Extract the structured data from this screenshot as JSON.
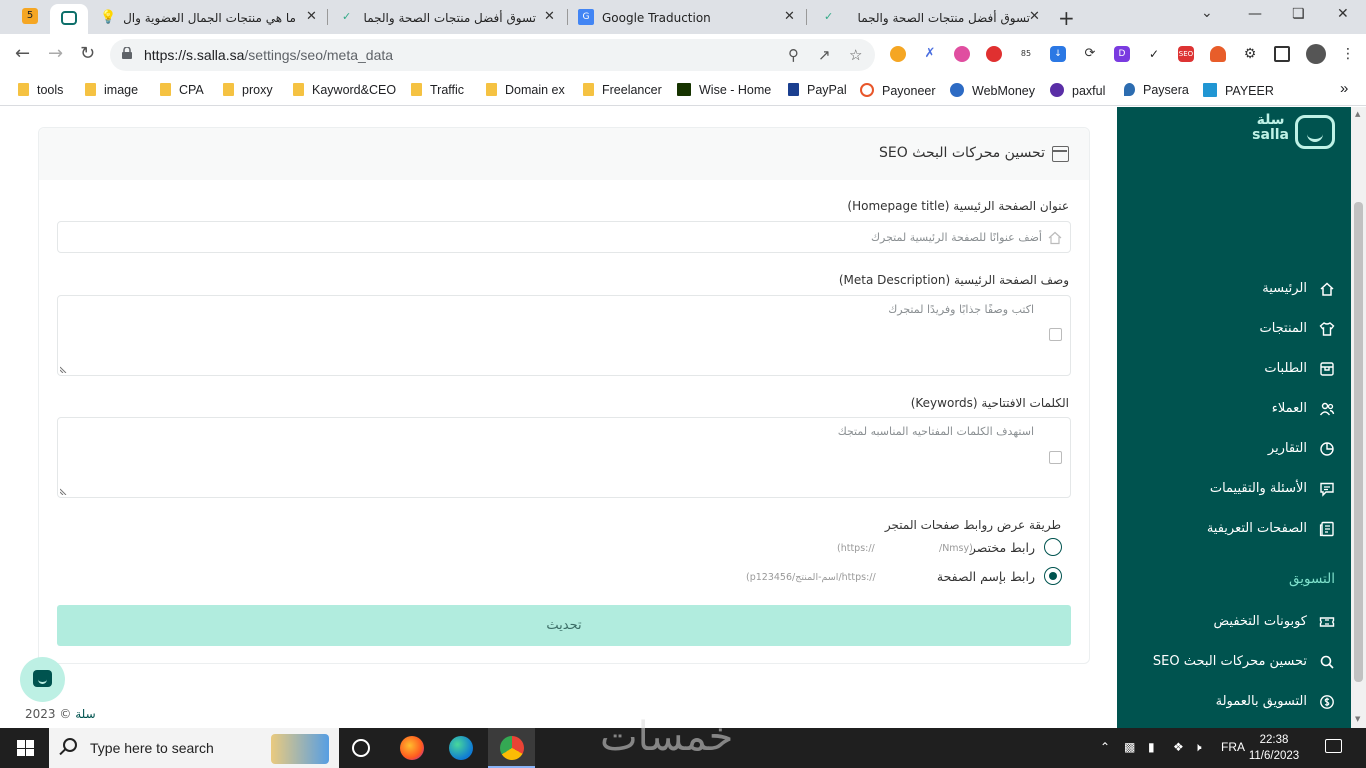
{
  "browser": {
    "tabs": [
      {
        "label": "ما هي منتجات الجمال العضوية وال"
      },
      {
        "label": "تسوق أفضل منتجات الصحة والجما"
      },
      {
        "label": "Google Traduction"
      },
      {
        "label": "تسوق أفضل منتجات الصحة والجما"
      }
    ],
    "new_tab": "+",
    "ext_badge": "5",
    "url_host": "https://s.salla.sa",
    "url_path": "/settings/seo/meta_data",
    "bookmarks": [
      {
        "label": "tools"
      },
      {
        "label": "image"
      },
      {
        "label": "CPA"
      },
      {
        "label": "proxy"
      },
      {
        "label": "Kayword&CEO"
      },
      {
        "label": "Traffic"
      },
      {
        "label": "Domain ex"
      },
      {
        "label": "Freelancer"
      },
      {
        "label": "Wise - Home"
      },
      {
        "label": "PayPal"
      },
      {
        "label": "Payoneer"
      },
      {
        "label": "WebMoney"
      },
      {
        "label": "paxful"
      },
      {
        "label": "Paysera"
      },
      {
        "label": "PAYEER"
      }
    ],
    "bookmarks_more": "»"
  },
  "sidebar": {
    "logo_ar": "سلة",
    "logo_en": "salla",
    "items": [
      {
        "label": "الرئيسية",
        "icon": "home-icon"
      },
      {
        "label": "المنتجات",
        "icon": "shirt-icon"
      },
      {
        "label": "الطلبات",
        "icon": "box-icon"
      },
      {
        "label": "العملاء",
        "icon": "users-icon"
      },
      {
        "label": "التقارير",
        "icon": "pie-chart-icon"
      },
      {
        "label": "الأسئلة والتقييمات",
        "icon": "comment-icon"
      },
      {
        "label": "الصفحات التعريفية",
        "icon": "pages-icon"
      }
    ],
    "section_marketing": "التسويق",
    "marketing_items": [
      {
        "label": "كوبونات التخفيض",
        "icon": "ticket-icon"
      },
      {
        "label": "تحسين محركات البحث SEO",
        "icon": "search-icon"
      },
      {
        "label": "التسويق بالعمولة",
        "icon": "dollar-icon"
      }
    ]
  },
  "card": {
    "title": "تحسين محركات البحث SEO",
    "homepage_title_label": "عنوان الصفحة الرئيسية (Homepage title)",
    "homepage_title_placeholder": "أضف عنوانًا للصفحة الرئيسية لمتجرك",
    "homepage_title_value": "",
    "meta_description_label": "وصف الصفحة الرئيسية (Meta Description)",
    "meta_description_placeholder": "اكتب وصفًا جذابًا وفريدًا لمتجرك",
    "meta_description_value": "",
    "keywords_label": "الكلمات الافتتاحية (Keywords)",
    "keywords_placeholder": "استهدف الكلمات المفتاحيه المناسبه لمتجك",
    "keywords_value": "",
    "link_style_label": "طريقة عرض روابط صفحات المتجر",
    "radio_short": {
      "label": "رابط مختصر",
      "hint_left": "(https://",
      "hint_right": "/Nmsy)",
      "checked": false
    },
    "radio_named": {
      "label": "رابط بإسم الصفحة",
      "hint": "(p123456/اسم-المنتج/https://",
      "checked": true
    },
    "submit_label": "تحديث"
  },
  "footer": {
    "brand": "سلة",
    "copyright": "© 2023"
  },
  "taskbar": {
    "search_placeholder": "Type here to search",
    "language": "FRA",
    "time": "22:38",
    "date": "11/6/2023",
    "watermark": "خمسات"
  },
  "colors": {
    "sidebar_bg": "#00534f",
    "accent_mint": "#b1ecde",
    "logo_mint": "#bff1e6"
  }
}
